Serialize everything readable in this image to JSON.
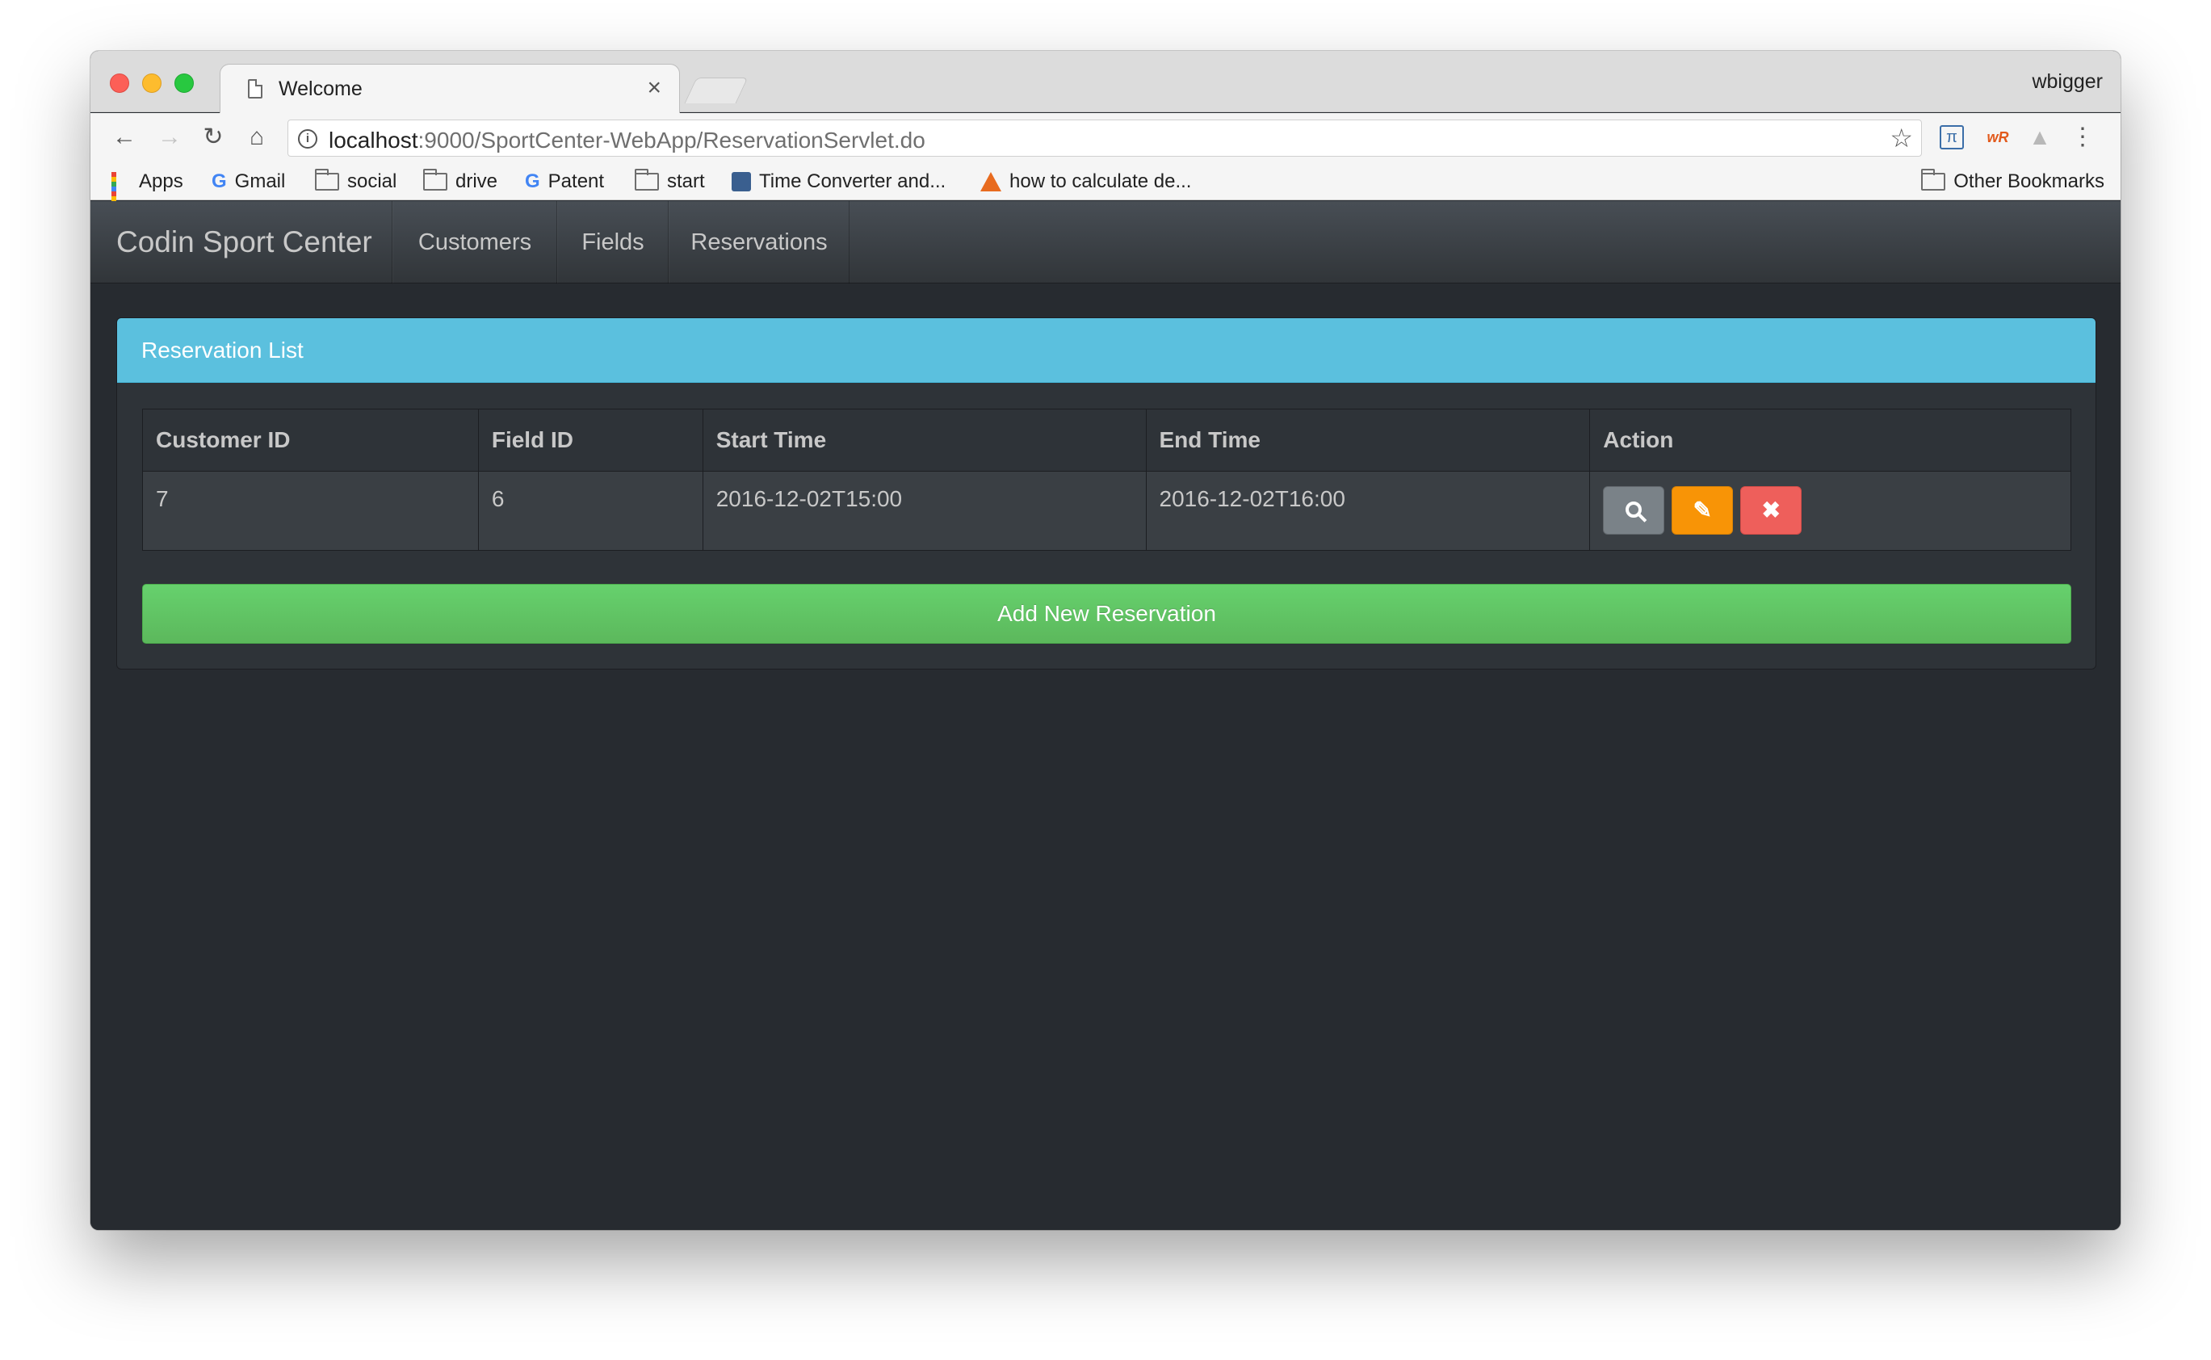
{
  "browser": {
    "tab_title": "Welcome",
    "tab_close": "×",
    "profile_name": "wbigger",
    "url_host": "localhost",
    "url_rest": ":9000/SportCenter-WebApp/ReservationServlet.do",
    "bookmarks": [
      {
        "label": "Apps",
        "icon": "apps-grid-icon"
      },
      {
        "label": "Gmail",
        "icon": "google-icon"
      },
      {
        "label": "social",
        "icon": "folder-icon"
      },
      {
        "label": "drive",
        "icon": "folder-icon"
      },
      {
        "label": "Patent",
        "icon": "google-icon"
      },
      {
        "label": "start",
        "icon": "folder-icon"
      },
      {
        "label": "Time Converter and...",
        "icon": "clock-icon"
      },
      {
        "label": "how to calculate de...",
        "icon": "matlab-icon"
      }
    ],
    "other_bookmarks": "Other Bookmarks"
  },
  "app": {
    "brand": "Codin Sport Center",
    "nav": [
      {
        "label": "Customers"
      },
      {
        "label": "Fields"
      },
      {
        "label": "Reservations"
      }
    ],
    "panel_title": "Reservation List",
    "table": {
      "headers": [
        "Customer ID",
        "Field ID",
        "Start Time",
        "End Time",
        "Action"
      ],
      "rows": [
        {
          "customer_id": "7",
          "field_id": "6",
          "start_time": "2016-12-02T15:00",
          "end_time": "2016-12-02T16:00"
        }
      ]
    },
    "add_button": "Add New Reservation"
  },
  "colors": {
    "panel_heading": "#5bc0de",
    "add_button": "#62c462",
    "view_button": "#7a8288",
    "edit_button": "#f89406",
    "delete_button": "#ee5f5b",
    "background": "#272b30"
  }
}
